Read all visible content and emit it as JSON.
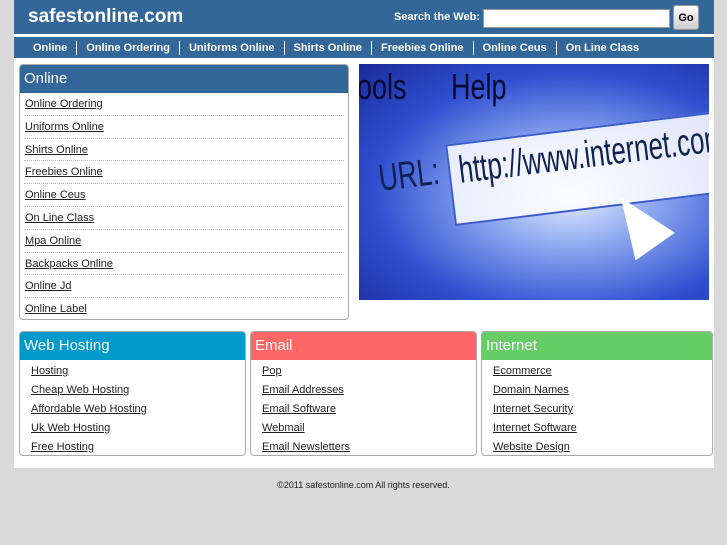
{
  "header": {
    "logo": "safestonline.com",
    "search_label": "Search the Web:",
    "search_value": "",
    "go_label": "Go"
  },
  "nav": [
    "Online",
    "Online Ordering",
    "Uniforms Online",
    "Shirts Online",
    "Freebies Online",
    "Online Ceus",
    "On Line Class"
  ],
  "panel": {
    "title": "Online",
    "items": [
      "Online Ordering",
      "Uniforms Online",
      "Shirts Online",
      "Freebies Online",
      "Online Ceus",
      "On Line Class",
      "Mpa Online",
      "Backpacks Online",
      "Online Jd",
      "Online Label"
    ]
  },
  "image": {
    "menu1": "ools",
    "menu2": "Help",
    "url_label": "URL:",
    "url": "http://www.internet.com"
  },
  "boxes": [
    {
      "title": "Web Hosting",
      "color": "#0099cc",
      "items": [
        "Hosting",
        "Cheap Web Hosting",
        "Affordable Web Hosting",
        "Uk Web Hosting",
        "Free Hosting"
      ]
    },
    {
      "title": "Email",
      "color": "#ff6666",
      "items": [
        "Pop",
        "Email Addresses",
        "Email Software",
        "Webmail",
        "Email Newsletters"
      ]
    },
    {
      "title": "Internet",
      "color": "#66cc66",
      "items": [
        "Ecommerce",
        "Domain Names",
        "Internet Security",
        "Internet Software",
        "Website Design"
      ]
    }
  ],
  "footer": "©2011 safestonline.com All rights reserved."
}
